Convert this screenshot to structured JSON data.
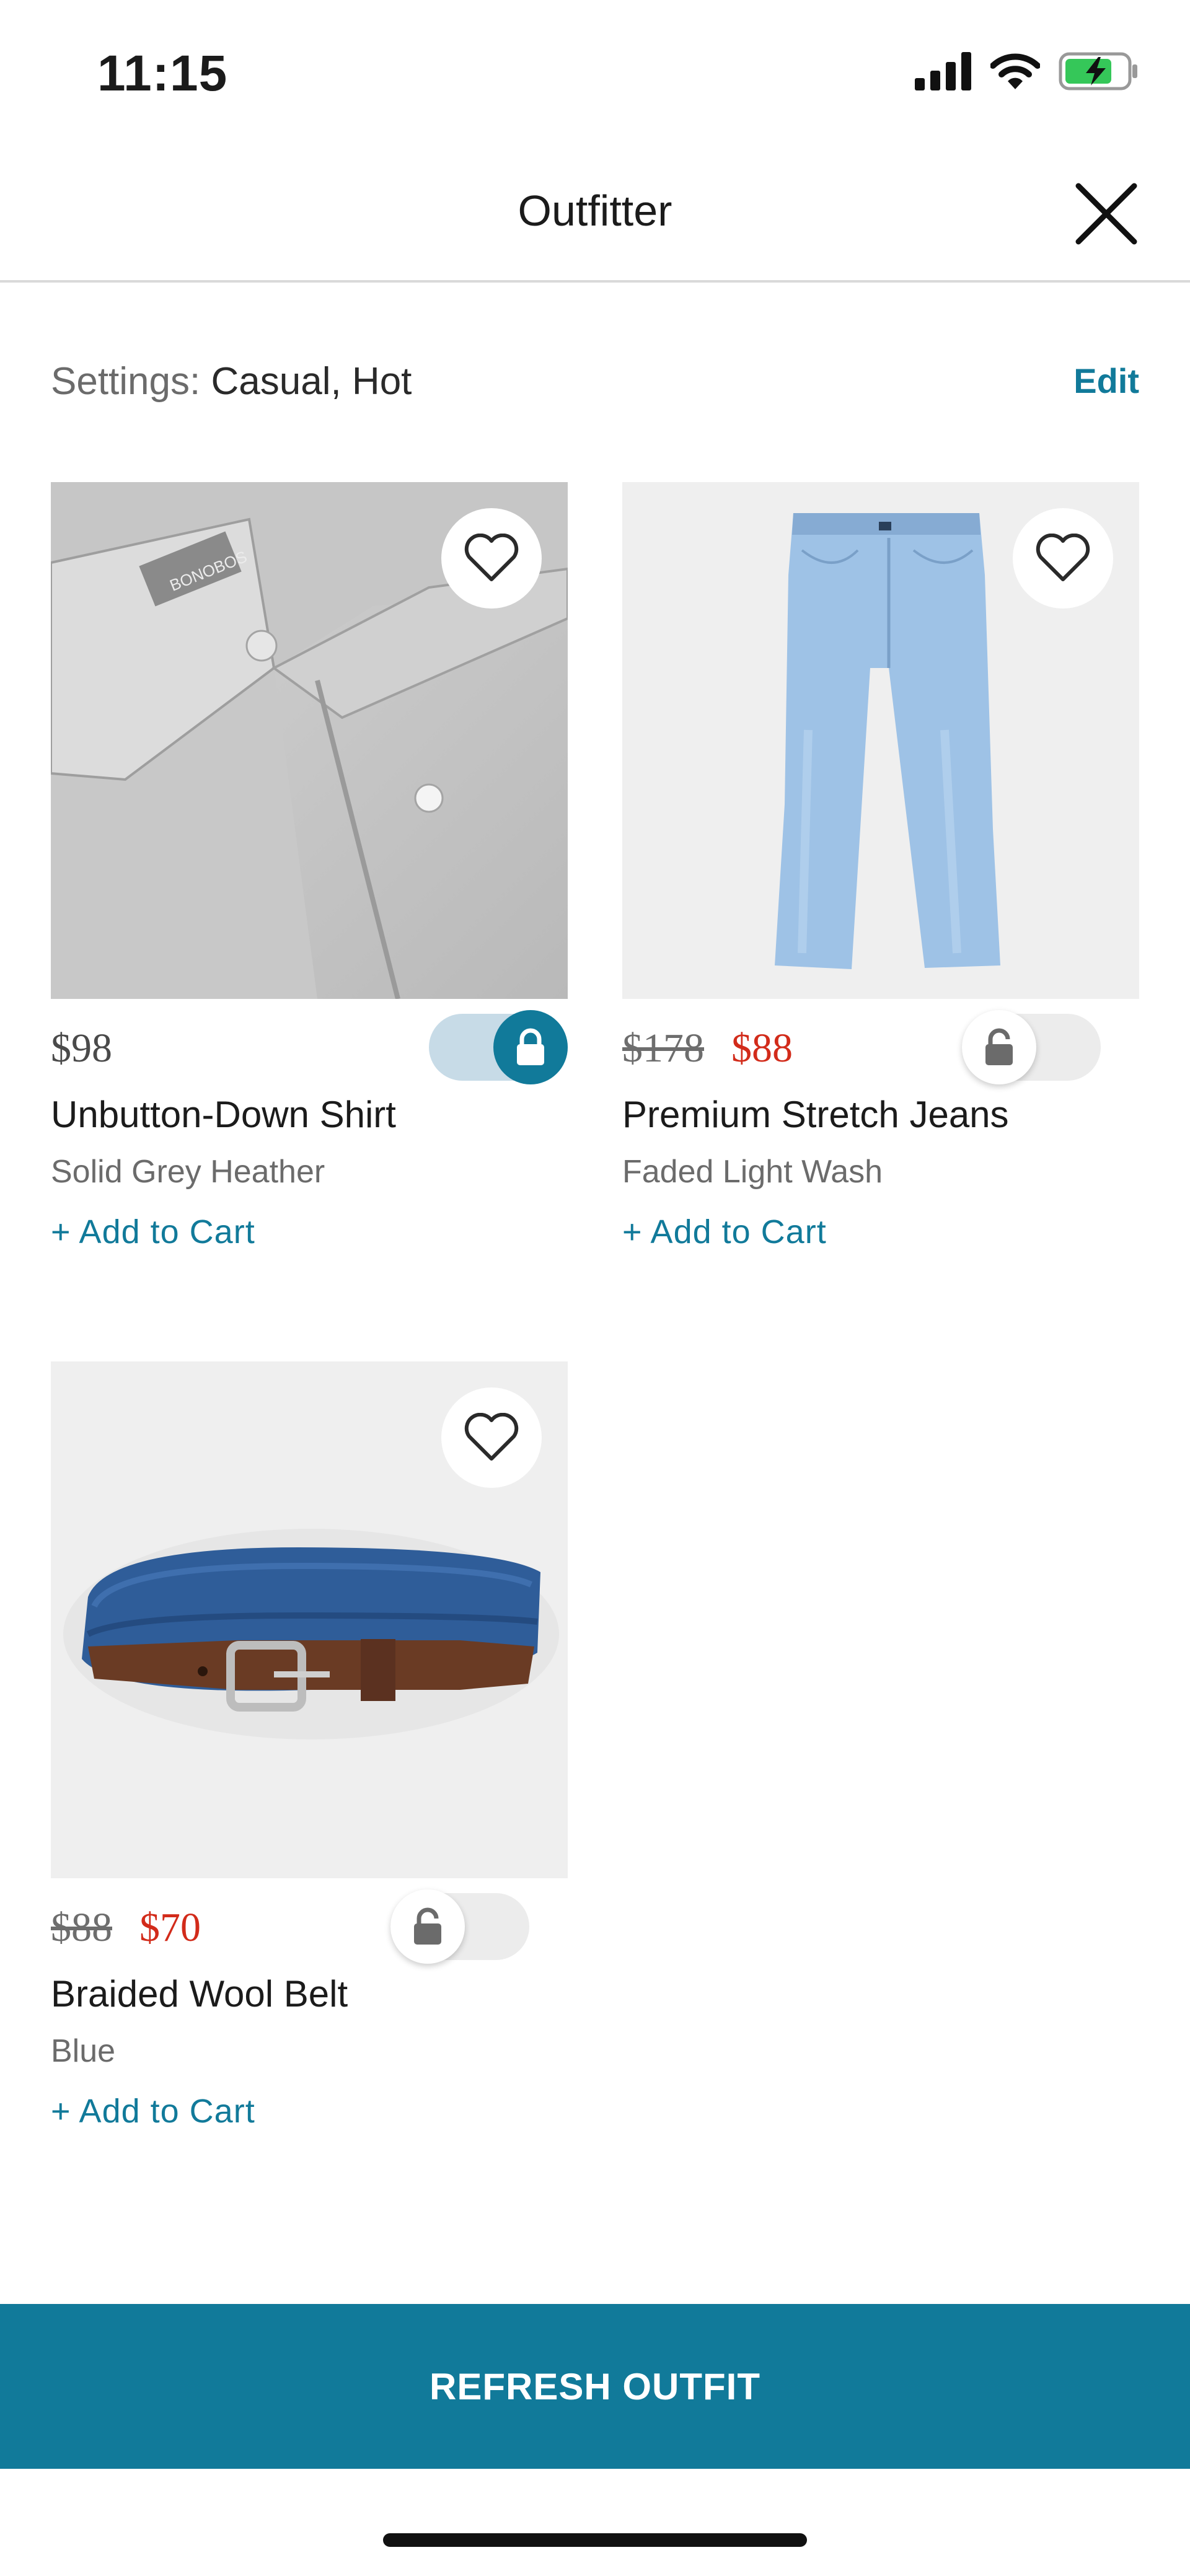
{
  "status": {
    "time": "11:15"
  },
  "header": {
    "title": "Outfitter"
  },
  "settings": {
    "label": "Settings:",
    "value": "Casual, Hot",
    "edit_label": "Edit"
  },
  "products": [
    {
      "price": "$98",
      "old_price": "",
      "sale_price": "",
      "name": "Unbutton-Down Shirt",
      "variant": "Solid Grey Heather",
      "add_label": "+ Add to Cart",
      "locked": true,
      "brand_tag": "BONOBOS"
    },
    {
      "price": "",
      "old_price": "$178",
      "sale_price": "$88",
      "name": "Premium Stretch Jeans",
      "variant": "Faded Light Wash",
      "add_label": "+ Add to Cart",
      "locked": false
    },
    {
      "price": "",
      "old_price": "$88",
      "sale_price": "$70",
      "name": "Braided Wool Belt",
      "variant": "Blue",
      "add_label": "+ Add to Cart",
      "locked": false
    }
  ],
  "footer": {
    "refresh_label": "REFRESH OUTFIT"
  },
  "colors": {
    "accent": "#117a9a",
    "sale": "#d22b1a",
    "toggle_on_track": "#c7dbe7",
    "toggle_off_track": "#ececec"
  }
}
